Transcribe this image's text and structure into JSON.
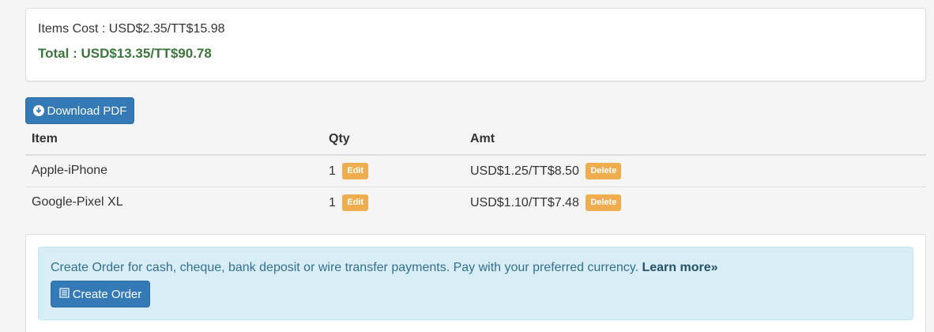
{
  "summary": {
    "items_cost": "Items Cost : USD$2.35/TT$15.98",
    "total": "Total : USD$13.35/TT$90.78"
  },
  "toolbar": {
    "download_label": "Download PDF",
    "download_icon": "circle-arrow-down-icon"
  },
  "table": {
    "headers": {
      "item": "Item",
      "qty": "Qty",
      "amt": "Amt"
    },
    "rows": [
      {
        "item": "Apple-iPhone",
        "qty": "1",
        "edit": "Edit",
        "amt": "USD$1.25/TT$8.50",
        "delete": "Delete"
      },
      {
        "item": "Google-Pixel XL",
        "qty": "1",
        "edit": "Edit",
        "amt": "USD$1.10/TT$7.48",
        "delete": "Delete"
      }
    ]
  },
  "order": {
    "info_text": "Create Order for cash, cheque, bank deposit or wire transfer payments. Pay with your preferred currency. ",
    "learn_more": "Learn more»",
    "create_label": "Create Order",
    "create_icon": "list-icon"
  },
  "colors": {
    "primary": "#337ab7",
    "success_text": "#3c763d",
    "warning": "#f0ad4e",
    "info_bg": "#d9edf7",
    "info_text": "#31708f"
  }
}
